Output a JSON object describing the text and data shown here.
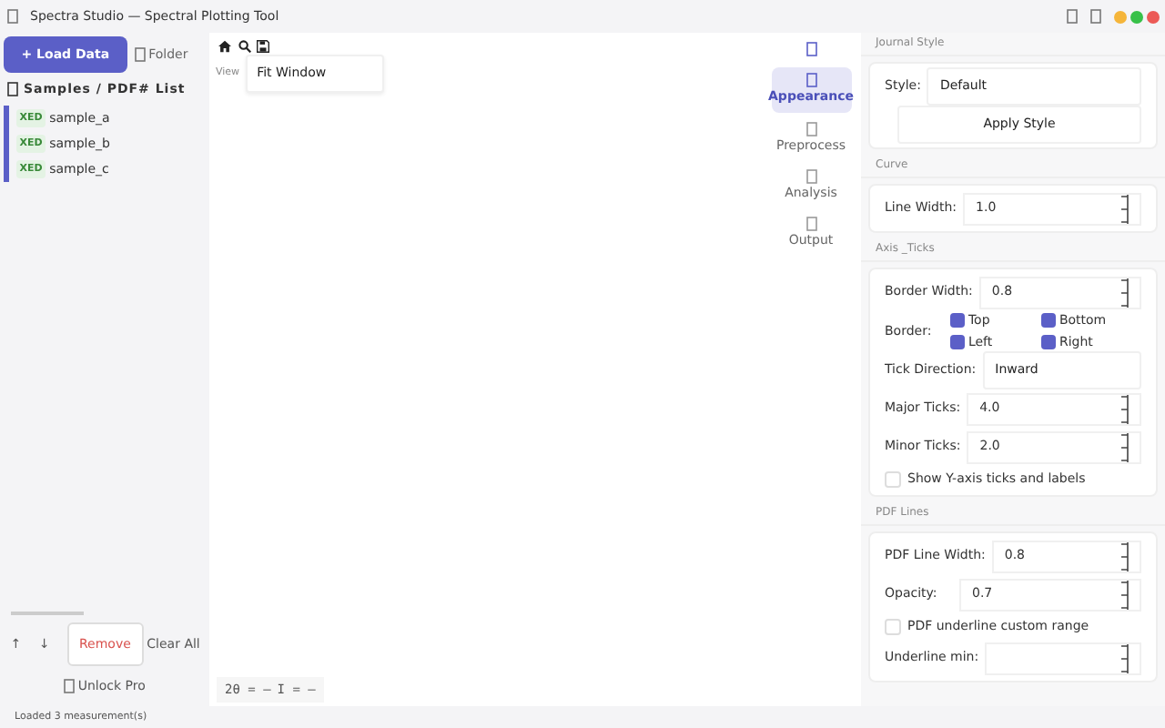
{
  "window": {
    "title": "Spectra Studio — Spectral Plotting Tool"
  },
  "sidebar": {
    "load_button": "+ Load Data",
    "folder_button": "Folder",
    "list_title": "Samples / PDF# List",
    "samples": [
      {
        "tag": "XED",
        "name": "sample_a"
      },
      {
        "tag": "XED",
        "name": "sample_b"
      },
      {
        "tag": "XED",
        "name": "sample_c"
      }
    ],
    "move_buttons": [
      "↑",
      "↓"
    ],
    "remove_button": "Remove",
    "clear_button": "Clear All",
    "unlock_button": "Unlock Pro"
  },
  "plot": {
    "view_label": "View",
    "view_value": "Fit Window",
    "coordinates": [
      "2θ = —",
      "I = —"
    ]
  },
  "nav": [
    {
      "label": "Appearance",
      "selected": true
    },
    {
      "label": "Preprocess",
      "selected": false
    },
    {
      "label": "Analysis",
      "selected": false
    },
    {
      "label": "Output",
      "selected": false
    }
  ],
  "panel": [
    {
      "title": "Journal Style",
      "rows": [
        {
          "kind": "select",
          "label": "Style:",
          "value": "Default"
        },
        {
          "kind": "button",
          "label": "Apply Style"
        }
      ]
    },
    {
      "title": "Curve",
      "rows": [
        {
          "kind": "spin",
          "label": "Line Width:",
          "value": "1.0"
        }
      ]
    },
    {
      "title": "Axis _Ticks",
      "rows": [
        {
          "kind": "spin",
          "label": "Border Width:",
          "value": "0.8"
        },
        {
          "kind": "checks",
          "label": "Border:",
          "options": [
            {
              "label": "Top",
              "checked": true
            },
            {
              "label": "Bottom",
              "checked": true
            },
            {
              "label": "Left",
              "checked": true
            },
            {
              "label": "Right",
              "checked": true
            }
          ]
        },
        {
          "kind": "select",
          "label": "Tick Direction:",
          "value": "Inward"
        },
        {
          "kind": "spin",
          "label": "Major Ticks:",
          "value": "4.0"
        },
        {
          "kind": "spin",
          "label": "Minor Ticks:",
          "value": "2.0"
        },
        {
          "kind": "checkbox",
          "label": "Show Y-axis ticks and labels",
          "checked": false
        }
      ]
    },
    {
      "title": "PDF Lines",
      "rows": [
        {
          "kind": "spin",
          "label": "PDF Line Width:",
          "value": "0.8"
        },
        {
          "kind": "spin",
          "label": "Opacity:",
          "value": "0.7"
        },
        {
          "kind": "checkbox",
          "label": "PDF underline custom range",
          "checked": false
        },
        {
          "kind": "spin",
          "label": "Underline min:"
        }
      ]
    }
  ],
  "status_bar": "Loaded 3 measurement(s)"
}
